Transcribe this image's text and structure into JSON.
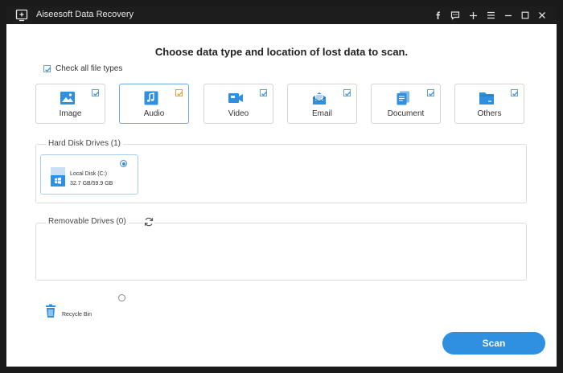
{
  "window": {
    "title": "Aiseesoft Data Recovery",
    "titlebar_icons": [
      "facebook-icon",
      "chat-icon",
      "plus-icon",
      "menu-icon",
      "minimize-icon",
      "maximize-icon",
      "close-icon"
    ]
  },
  "main": {
    "heading": "Choose data type and location of lost data to scan.",
    "check_all": {
      "label": "Check all file types",
      "checked": true
    },
    "file_types": [
      {
        "label": "Image",
        "icon": "image-icon",
        "checked": true
      },
      {
        "label": "Audio",
        "icon": "audio-icon",
        "checked": true
      },
      {
        "label": "Video",
        "icon": "video-icon",
        "checked": true
      },
      {
        "label": "Email",
        "icon": "email-icon",
        "checked": true
      },
      {
        "label": "Document",
        "icon": "document-icon",
        "checked": true
      },
      {
        "label": "Others",
        "icon": "others-folder-icon",
        "checked": true
      }
    ]
  },
  "hard_disk": {
    "title": "Hard Disk Drives (1)",
    "drives": [
      {
        "name": "Local Disk (C:)",
        "size": "32.7 GB/59.9 GB",
        "selected": true
      }
    ]
  },
  "removable": {
    "title": "Removable Drives (0)",
    "refresh_icon": "refresh-icon"
  },
  "recycle_bin": {
    "label": "Recycle Bin",
    "selected": false
  },
  "actions": {
    "scan_label": "Scan"
  },
  "colors": {
    "accent": "#2f8fe0",
    "titlebar": "#1d1d1d",
    "audio_checkbox": "#e8a33a"
  }
}
